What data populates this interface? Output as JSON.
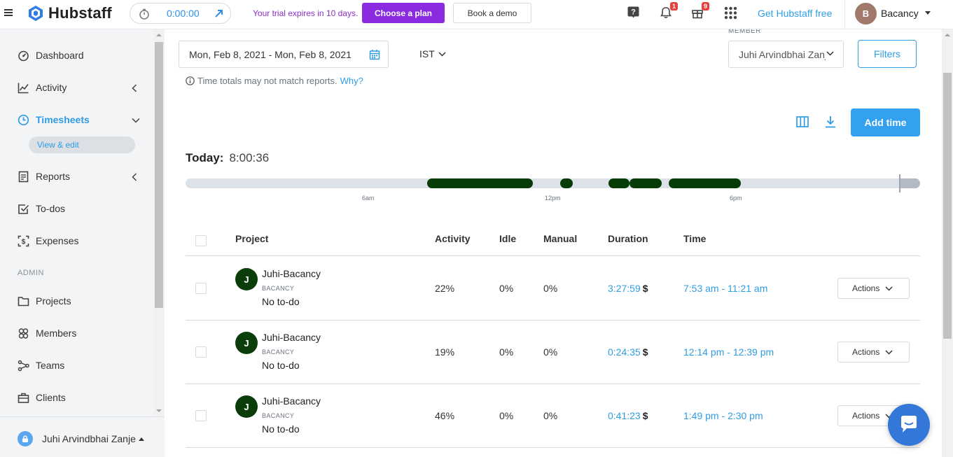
{
  "app": {
    "logo_text": "Hubstaff"
  },
  "topbar": {
    "timer_value": "0:00:00",
    "trial_text": "Your trial expires in 10 days.",
    "plan_button": "Choose a plan",
    "demo_button": "Book a demo",
    "notifications_count": "1",
    "gifts_count": "9",
    "get_free": "Get Hubstaff free",
    "user_initial": "B",
    "user_name": "Bacancy"
  },
  "sidebar": {
    "items": [
      {
        "label": "Dashboard"
      },
      {
        "label": "Activity"
      },
      {
        "label": "Timesheets"
      },
      {
        "label": "Reports"
      },
      {
        "label": "To-dos"
      },
      {
        "label": "Expenses"
      },
      {
        "label": "Projects"
      },
      {
        "label": "Members"
      },
      {
        "label": "Teams"
      },
      {
        "label": "Clients"
      }
    ],
    "sub_item": "View & edit",
    "section_admin": "ADMIN",
    "footer_user": "Juhi Arvindbhai Zanje"
  },
  "filters": {
    "date_range": "Mon, Feb 8, 2021 - Mon, Feb 8, 2021",
    "timezone": "IST",
    "member_label": "MEMBER",
    "member_value": "Juhi Arvindbhai Zanje",
    "filters_button": "Filters",
    "note_text": "Time totals may not match reports.",
    "note_link": "Why?"
  },
  "actions": {
    "add_time": "Add time"
  },
  "today": {
    "label": "Today:",
    "value": "8:00:36"
  },
  "timeline": {
    "ticks": [
      "6am",
      "12pm",
      "6pm"
    ],
    "segments": [
      {
        "start": "7:53 am",
        "end": "11:21 am"
      },
      {
        "start": "12:14 pm",
        "end": "12:39 pm"
      },
      {
        "start": "1:49 pm",
        "end": "2:30 pm"
      }
    ],
    "colors": {
      "tracked": "#063c06",
      "track": "#dde2ea"
    }
  },
  "table": {
    "headers": {
      "project": "Project",
      "activity": "Activity",
      "idle": "Idle",
      "manual": "Manual",
      "duration": "Duration",
      "time": "Time"
    },
    "rows": [
      {
        "initial": "J",
        "project": "Juhi-Bacancy",
        "org": "BACANCY",
        "todo": "No to-do",
        "activity": "22%",
        "idle": "0%",
        "manual": "0%",
        "duration": "3:27:59",
        "currency": "$",
        "time": "7:53 am - 11:21 am",
        "action": "Actions"
      },
      {
        "initial": "J",
        "project": "Juhi-Bacancy",
        "org": "BACANCY",
        "todo": "No to-do",
        "activity": "19%",
        "idle": "0%",
        "manual": "0%",
        "duration": "0:24:35",
        "currency": "$",
        "time": "12:14 pm - 12:39 pm",
        "action": "Actions"
      },
      {
        "initial": "J",
        "project": "Juhi-Bacancy",
        "org": "BACANCY",
        "todo": "No to-do",
        "activity": "46%",
        "idle": "0%",
        "manual": "0%",
        "duration": "0:41:23",
        "currency": "$",
        "time": "1:49 pm - 2:30 pm",
        "action": "Actions"
      }
    ]
  },
  "colors": {
    "accent": "#2f9de4",
    "plan_purple": "#8a2be2",
    "add_button": "#33a1f0"
  }
}
